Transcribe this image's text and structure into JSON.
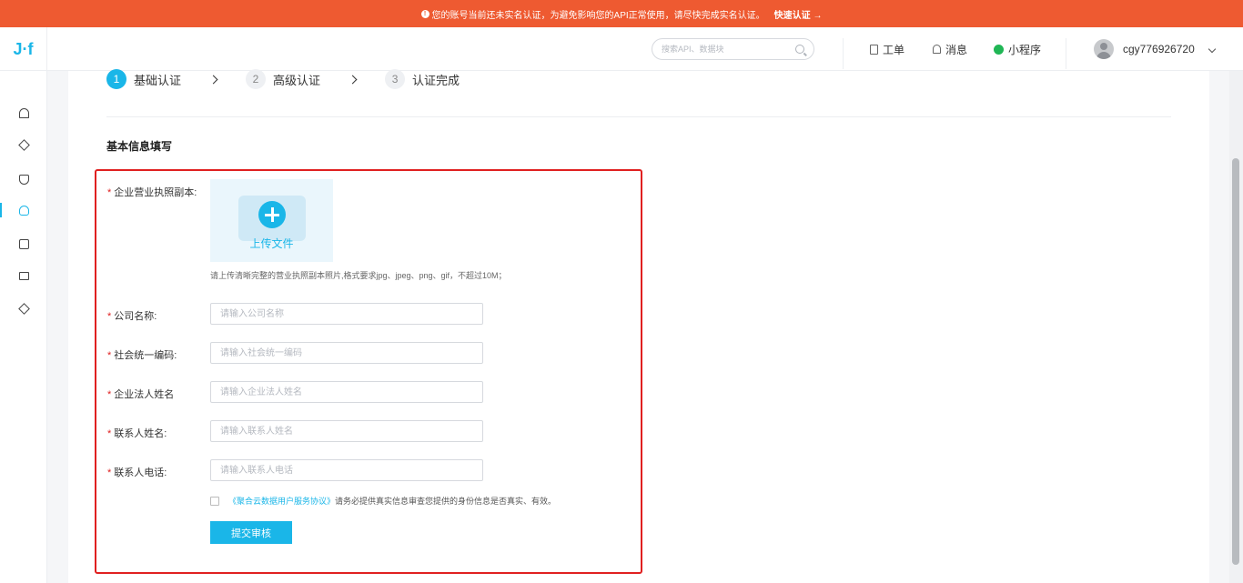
{
  "banner": {
    "message": "您的账号当前还未实名认证，为避免影响您的API正常使用，请尽快完成实名认证。",
    "link": "快速认证 →"
  },
  "header": {
    "logo": "J·f",
    "search_placeholder": "搜索API、数据块",
    "ticket": "工单",
    "messages": "消息",
    "miniprogram": "小程序",
    "username": "cgy776926720"
  },
  "sidebar": {
    "items": [
      "home-icon",
      "layers-icon",
      "shield-icon",
      "user-icon",
      "document-icon",
      "briefcase-icon",
      "stack-icon"
    ],
    "active_index": 3
  },
  "steps": [
    {
      "num": "1",
      "label": "基础认证",
      "active": true
    },
    {
      "num": "2",
      "label": "高级认证",
      "active": false
    },
    {
      "num": "3",
      "label": "认证完成",
      "active": false
    }
  ],
  "section_title": "基本信息填写",
  "form": {
    "license_label": "企业营业执照副本:",
    "upload_text": "上传文件",
    "upload_hint": "请上传清晰完整的营业执照副本照片,格式要求jpg、jpeg、png、gif，不超过10M；",
    "fields": [
      {
        "label": "公司名称:",
        "placeholder": "请输入公司名称"
      },
      {
        "label": "社会统一编码:",
        "placeholder": "请输入社会统一编码"
      },
      {
        "label": "企业法人姓名",
        "placeholder": "请输入企业法人姓名"
      },
      {
        "label": "联系人姓名:",
        "placeholder": "请输入联系人姓名"
      },
      {
        "label": "联系人电话:",
        "placeholder": "请输入联系人电话"
      }
    ],
    "agreement_link": "《聚合云数据用户服务协议》",
    "agreement_text": "请务必提供真实信息审查您提供的身份信息是否真实、有效。",
    "submit": "提交审核"
  }
}
